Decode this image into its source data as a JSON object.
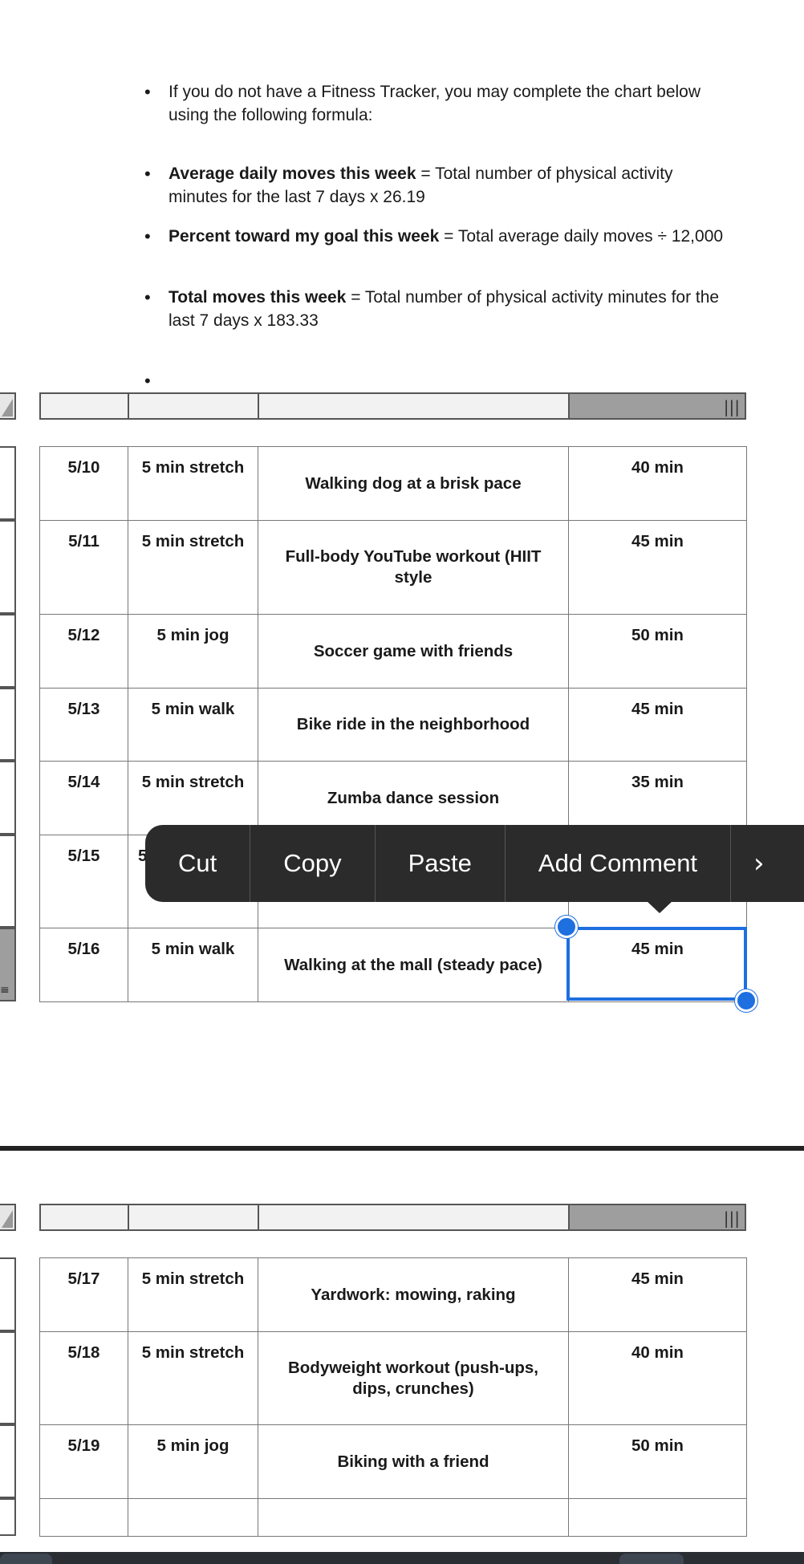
{
  "instructions": [
    {
      "bold": "",
      "text": "If you do not have a Fitness Tracker, you may complete the chart below using the following formula:"
    },
    {
      "bold": "Average daily moves this week",
      "text": " = Total number of physical activity minutes for the last 7 days x 26.19"
    },
    {
      "bold": "Percent toward my goal this week",
      "text": " = Total average daily moves ÷ 12,000"
    },
    {
      "bold": "Total moves this week",
      "text": " = Total number of physical activity minutes for the last 7 days x 183.33"
    }
  ],
  "table1": {
    "rows": [
      {
        "date": "5/10",
        "warmup": "5 min stretch",
        "activity": "Walking dog at a brisk pace",
        "minutes": "40 min"
      },
      {
        "date": "5/11",
        "warmup": "5 min stretch",
        "activity": "Full-body YouTube workout (HIIT style",
        "minutes": "45 min"
      },
      {
        "date": "5/12",
        "warmup": "5 min jog",
        "activity": "Soccer game with friends",
        "minutes": "50 min"
      },
      {
        "date": "5/13",
        "warmup": "5 min walk",
        "activity": "Bike ride in the neighborhood",
        "minutes": "45 min"
      },
      {
        "date": "5/14",
        "warmup": "5 min stretch",
        "activity": "Zumba dance session",
        "minutes": "35 min"
      },
      {
        "date": "5/15",
        "warmup": "5",
        "activity": "",
        "minutes": ""
      },
      {
        "date": "5/16",
        "warmup": "5 min walk",
        "activity": "Walking at the mall (steady pace)",
        "minutes": "45 min"
      }
    ]
  },
  "table2": {
    "rows": [
      {
        "date": "5/17",
        "warmup": "5 min stretch",
        "activity": "Yardwork: mowing, raking",
        "minutes": "45 min"
      },
      {
        "date": "5/18",
        "warmup": "5 min stretch",
        "activity": "Bodyweight workout (push-ups, dips, crunches)",
        "minutes": "40 min"
      },
      {
        "date": "5/19",
        "warmup": "5 min jog",
        "activity": "Biking with a friend",
        "minutes": "50 min"
      },
      {
        "date": "",
        "warmup": "",
        "activity": "",
        "minutes": ""
      }
    ]
  },
  "context_menu": {
    "items": [
      "Cut",
      "Copy",
      "Paste",
      "Add Comment"
    ],
    "more_icon": "chevron-right-icon"
  },
  "colors": {
    "selection": "#1e6fe0",
    "menu_bg": "#2b2b2b",
    "header_selected": "#9e9e9e"
  }
}
